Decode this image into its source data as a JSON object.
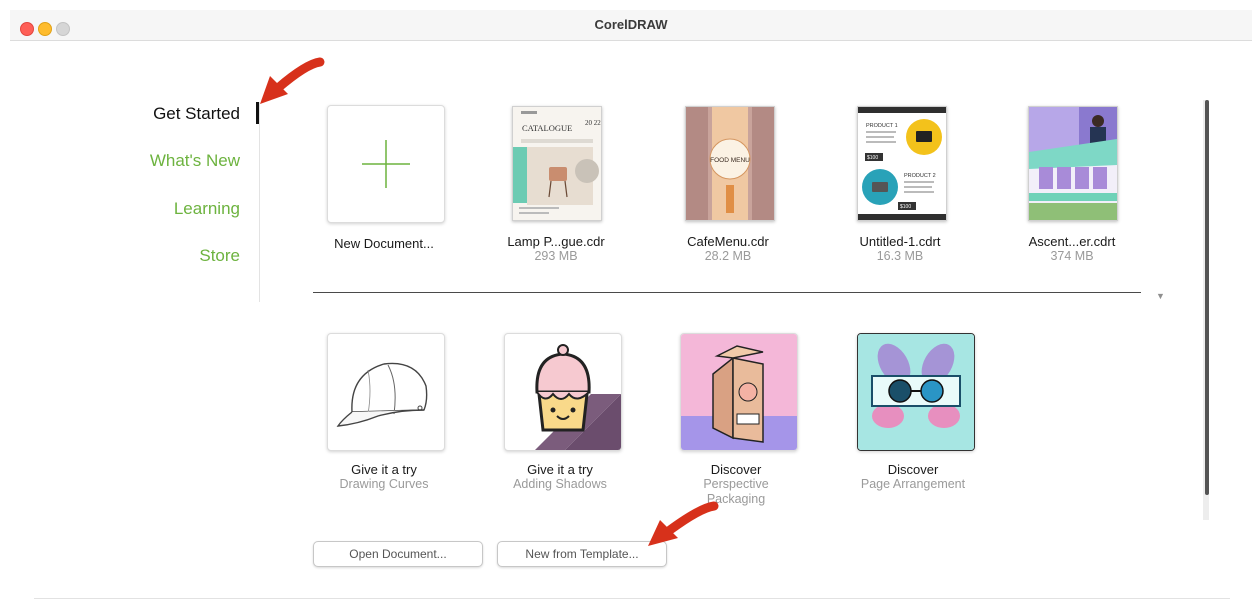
{
  "window": {
    "title": "CorelDRAW"
  },
  "nav": {
    "items": [
      {
        "label": "Get Started",
        "active": true
      },
      {
        "label": "What's New",
        "active": false
      },
      {
        "label": "Learning",
        "active": false
      },
      {
        "label": "Store",
        "active": false
      }
    ]
  },
  "recent": [
    {
      "name": "New Document...",
      "size": ""
    },
    {
      "name": "Lamp P...gue.cdr",
      "size": "293 MB"
    },
    {
      "name": "CafeMenu.cdr",
      "size": "28.2 MB"
    },
    {
      "name": "Untitled-1.cdrt",
      "size": "16.3 MB"
    },
    {
      "name": "Ascent...er.cdrt",
      "size": "374 MB"
    }
  ],
  "thumb_text": {
    "catalogue": "CATALOGUE",
    "year": "20 22",
    "food_menu": "FOOD MENU",
    "product1": "PRODUCT 1",
    "product2": "PRODUCT 2",
    "price1": "$100",
    "price2": "$100"
  },
  "learn": [
    {
      "title": "Give it a try",
      "subtitle": "Drawing Curves"
    },
    {
      "title": "Give it a try",
      "subtitle": "Adding Shadows"
    },
    {
      "title": "Discover",
      "subtitle": "Perspective Packaging"
    },
    {
      "title": "Discover",
      "subtitle": "Page Arrangement"
    }
  ],
  "buttons": {
    "open": "Open Document...",
    "template": "New from Template..."
  },
  "colors": {
    "accent_green": "#6db33f",
    "annotation_red": "#d7311b"
  }
}
